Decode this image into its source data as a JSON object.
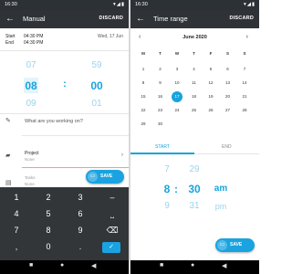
{
  "left": {
    "status_time": "16:30",
    "title": "Manual",
    "action": "DISCARD",
    "start_label": "Start",
    "start_time": "04:30 PM",
    "start_date": "Wed, 17 Jun",
    "end_label": "End",
    "end_time": "04:30 PM",
    "hours": [
      "07",
      "08",
      "09"
    ],
    "colon": ":",
    "minutes": [
      "59",
      "00",
      "01"
    ],
    "description_placeholder": "What are you working on?",
    "project_label": "Project",
    "project_value": "None",
    "tasks_label": "Tasks",
    "tasks_value": "None",
    "save": "SAVE",
    "keys": [
      "1",
      "2",
      "3",
      "–",
      "4",
      "5",
      "6",
      "⎵",
      "7",
      "8",
      "9",
      "⌫",
      ",",
      "0",
      ".",
      "✓"
    ]
  },
  "right": {
    "status_time": "16:30",
    "title": "Time range",
    "action": "DISCARD",
    "month": "June 2020",
    "weekdays": [
      "M",
      "T",
      "W",
      "T",
      "F",
      "S",
      "S"
    ],
    "weeks": [
      [
        "1",
        "2",
        "3",
        "4",
        "5",
        "6",
        "7"
      ],
      [
        "8",
        "9",
        "10",
        "11",
        "12",
        "13",
        "14"
      ],
      [
        "15",
        "16",
        "17",
        "18",
        "19",
        "20",
        "21"
      ],
      [
        "22",
        "23",
        "24",
        "25",
        "26",
        "27",
        "28"
      ],
      [
        "29",
        "30",
        "",
        "",
        "",
        "",
        ""
      ]
    ],
    "selected_day": "17",
    "tab_start": "START",
    "tab_end": "END",
    "hours": [
      "7",
      "8",
      "9"
    ],
    "colon": ":",
    "minutes": [
      "29",
      "30",
      "31"
    ],
    "ampm": [
      "am",
      "pm"
    ],
    "save": "SAVE"
  },
  "colors": {
    "accent": "#17a4dc",
    "appbar": "#2f3337",
    "keypad": "#323639"
  }
}
